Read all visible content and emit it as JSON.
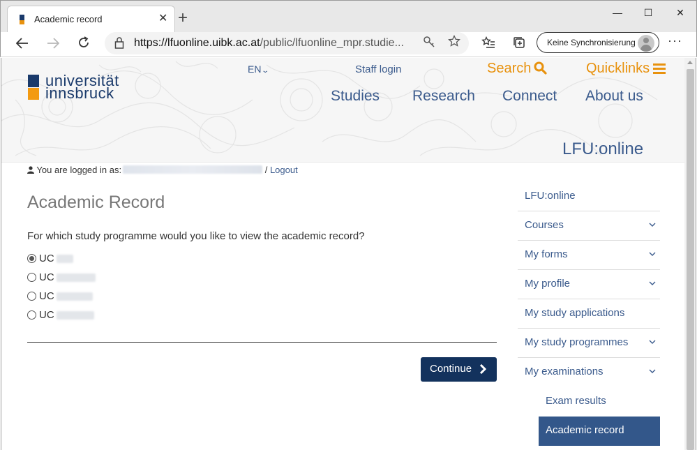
{
  "browser": {
    "tab_title": "Academic record",
    "url_host": "https://lfuonline.uibk.ac.at",
    "url_path": "/public/lfuonline_mpr.studie...",
    "sync_label": "Keine Synchronisierung",
    "new_tab": "+",
    "close_tab": "✕",
    "more": "···",
    "minimize": "—",
    "maximize": "☐",
    "close_window": "✕"
  },
  "header": {
    "logo_line1": "universität",
    "logo_line2": "innsbruck",
    "language": "EN",
    "staff_login": "Staff login",
    "search": "Search",
    "quicklinks": "Quicklinks",
    "nav": [
      "Studies",
      "Research",
      "Connect",
      "About us"
    ],
    "portal_title": "LFU:online"
  },
  "login": {
    "prefix": "You are logged in as:",
    "separator": "/",
    "logout": "Logout"
  },
  "main": {
    "title": "Academic Record",
    "question": "For which study programme would you like to view the academic record?",
    "options": [
      {
        "label": "UC",
        "checked": true
      },
      {
        "label": "UC",
        "checked": false
      },
      {
        "label": "UC",
        "checked": false
      },
      {
        "label": "UC",
        "checked": false
      }
    ],
    "continue_label": "Continue"
  },
  "sidebar": {
    "items": [
      {
        "label": "LFU:online",
        "expandable": false
      },
      {
        "label": "Courses",
        "expandable": true
      },
      {
        "label": "My forms",
        "expandable": true
      },
      {
        "label": "My profile",
        "expandable": true
      },
      {
        "label": "My study applications",
        "expandable": false
      },
      {
        "label": "My study programmes",
        "expandable": true
      },
      {
        "label": "My examinations",
        "expandable": true
      },
      {
        "label": "Exam results",
        "expandable": false
      },
      {
        "label": "Academic record",
        "expandable": false
      }
    ]
  },
  "colors": {
    "brand_blue": "#1a3a6b",
    "brand_orange": "#e8920e",
    "link_blue": "#3a5a8c",
    "button_dark": "#13325d",
    "active_item": "#33578a"
  }
}
